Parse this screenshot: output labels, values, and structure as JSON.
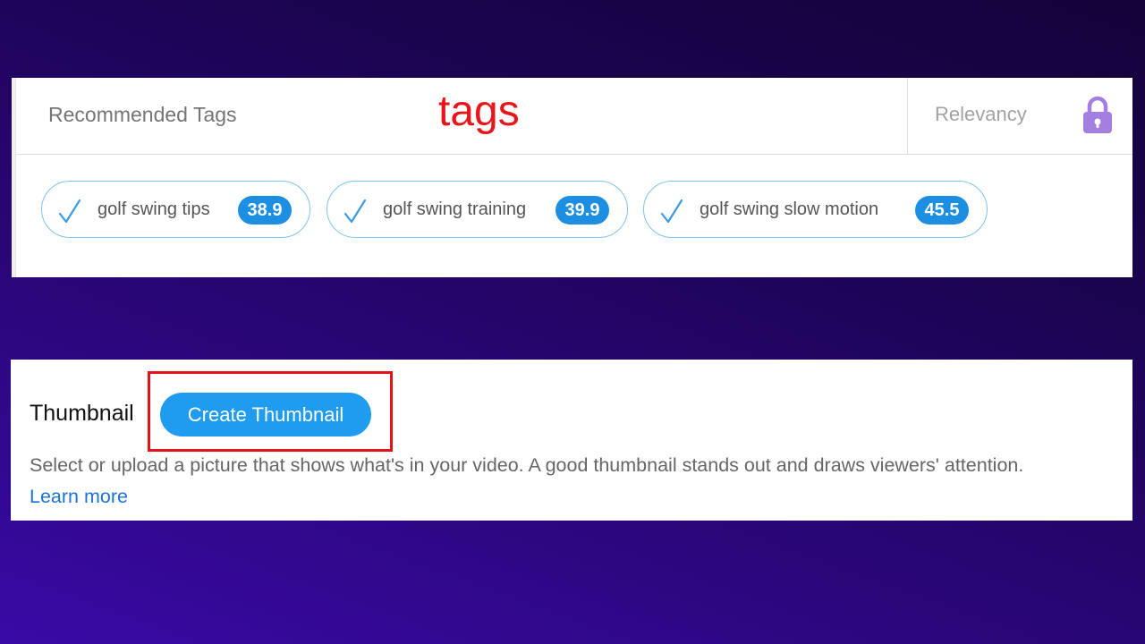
{
  "tags_panel": {
    "title": "Recommended Tags",
    "annotation": "tags",
    "relevancy_label": "Relevancy",
    "lock_icon": "lock-icon",
    "lock_color": "#a47ee0",
    "tags": [
      {
        "label": "golf swing tips",
        "score": "38.9",
        "checked": true
      },
      {
        "label": "golf swing training",
        "score": "39.9",
        "checked": true
      },
      {
        "label": "golf swing slow motion",
        "score": "45.5",
        "checked": true
      }
    ]
  },
  "thumbnail_panel": {
    "title": "Thumbnail",
    "create_button_label": "Create Thumbnail",
    "description": "Select or upload a picture that shows what's in your video. A good thumbnail stands out and draws viewers' attention.",
    "learn_more": "Learn more"
  },
  "colors": {
    "accent": "#1f9bf0",
    "score_badge": "#1c8fe3",
    "annotation_red": "#e8161b",
    "chip_border": "#7fc3ee"
  }
}
